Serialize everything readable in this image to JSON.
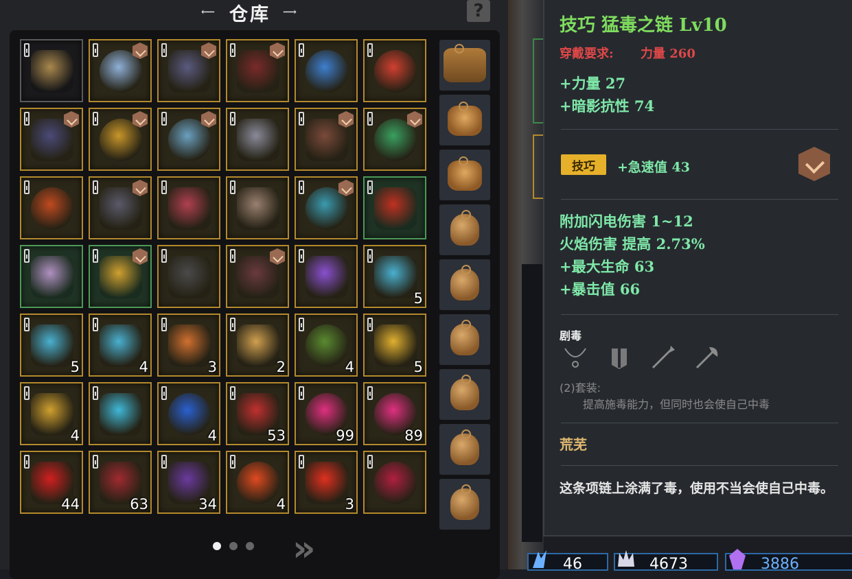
{
  "warehouse": {
    "title": "仓库",
    "help_label": "?",
    "items": [
      {
        "row": 0,
        "col": 0,
        "name": "backpack-item",
        "style": "dark",
        "rank": false,
        "count": "",
        "color": "#a9884d"
      },
      {
        "row": 0,
        "col": 1,
        "name": "ring-item",
        "style": "gold",
        "rank": true,
        "count": "",
        "color": "#8fb0d8"
      },
      {
        "row": 0,
        "col": 2,
        "name": "staff-item",
        "style": "gold",
        "rank": true,
        "count": "",
        "color": "#5a5a80"
      },
      {
        "row": 0,
        "col": 3,
        "name": "spiked-mace-item",
        "style": "gold",
        "rank": true,
        "count": "",
        "color": "#7a2a2a"
      },
      {
        "row": 0,
        "col": 4,
        "name": "blue-ring-item",
        "style": "gold",
        "rank": false,
        "count": "",
        "color": "#3e7fd0"
      },
      {
        "row": 0,
        "col": 5,
        "name": "ruby-ring-item",
        "style": "gold",
        "rank": false,
        "count": "",
        "color": "#d04030"
      },
      {
        "row": 1,
        "col": 0,
        "name": "boots-item",
        "style": "gold",
        "rank": true,
        "count": "",
        "color": "#4a4a78"
      },
      {
        "row": 1,
        "col": 1,
        "name": "gold-ring-item",
        "style": "gold",
        "rank": true,
        "count": "",
        "color": "#c8962a"
      },
      {
        "row": 1,
        "col": 2,
        "name": "gem-ring-item",
        "style": "gold",
        "rank": true,
        "count": "",
        "color": "#6aa0c0"
      },
      {
        "row": 1,
        "col": 3,
        "name": "helmet-item",
        "style": "gold",
        "rank": false,
        "count": "",
        "color": "#8a8a9a"
      },
      {
        "row": 1,
        "col": 4,
        "name": "club-item",
        "style": "gold",
        "rank": true,
        "count": "",
        "color": "#7a4a3a"
      },
      {
        "row": 1,
        "col": 5,
        "name": "emerald-ring-item",
        "style": "gold",
        "rank": true,
        "count": "",
        "color": "#3aa060"
      },
      {
        "row": 2,
        "col": 0,
        "name": "red-ring-item",
        "style": "gold",
        "rank": false,
        "count": "",
        "color": "#c04a20"
      },
      {
        "row": 2,
        "col": 1,
        "name": "scythe-item",
        "style": "gold",
        "rank": true,
        "count": "",
        "color": "#5a5a6a"
      },
      {
        "row": 2,
        "col": 2,
        "name": "robe-item",
        "style": "gold",
        "rank": false,
        "count": "",
        "color": "#b04050"
      },
      {
        "row": 2,
        "col": 3,
        "name": "armor-item",
        "style": "gold",
        "rank": false,
        "count": "",
        "color": "#9a8070"
      },
      {
        "row": 2,
        "col": 4,
        "name": "teal-ring-item",
        "style": "gold",
        "rank": true,
        "count": "",
        "color": "#3a9ab0"
      },
      {
        "row": 2,
        "col": 5,
        "name": "spear-item",
        "style": "green",
        "rank": false,
        "count": "",
        "color": "#c03020"
      },
      {
        "row": 3,
        "col": 0,
        "name": "blade-item",
        "style": "green",
        "rank": false,
        "count": "",
        "color": "#b090c0"
      },
      {
        "row": 3,
        "col": 1,
        "name": "necklace-item",
        "style": "green",
        "rank": true,
        "count": "",
        "color": "#d0a030"
      },
      {
        "row": 3,
        "col": 2,
        "name": "sword-item",
        "style": "gold",
        "rank": false,
        "count": "",
        "color": "#4a4a4a"
      },
      {
        "row": 3,
        "col": 3,
        "name": "scepter-item",
        "style": "gold",
        "rank": true,
        "count": "",
        "color": "#6a3a40"
      },
      {
        "row": 3,
        "col": 4,
        "name": "amethyst-item",
        "style": "gold",
        "rank": false,
        "count": "",
        "color": "#8a50d0"
      },
      {
        "row": 3,
        "col": 5,
        "name": "blue-scroll-item",
        "style": "gold",
        "rank": false,
        "count": "5",
        "color": "#4ab0d0"
      },
      {
        "row": 4,
        "col": 0,
        "name": "blue-scroll-item",
        "style": "gold",
        "rank": false,
        "count": "5",
        "color": "#4ab0d0"
      },
      {
        "row": 4,
        "col": 1,
        "name": "blue-scroll-item",
        "style": "gold",
        "rank": false,
        "count": "4",
        "color": "#4ab0d0"
      },
      {
        "row": 4,
        "col": 2,
        "name": "red-scroll-item",
        "style": "gold",
        "rank": false,
        "count": "3",
        "color": "#d07030"
      },
      {
        "row": 4,
        "col": 3,
        "name": "parchment-item",
        "style": "gold",
        "rank": false,
        "count": "2",
        "color": "#d0a050"
      },
      {
        "row": 4,
        "col": 4,
        "name": "green-rune-item",
        "style": "gold",
        "rank": false,
        "count": "4",
        "color": "#5a8a30"
      },
      {
        "row": 4,
        "col": 5,
        "name": "yellow-scroll-item",
        "style": "gold",
        "rank": false,
        "count": "5",
        "color": "#e0b030"
      },
      {
        "row": 5,
        "col": 0,
        "name": "yellow-scroll-item",
        "style": "gold",
        "rank": false,
        "count": "4",
        "color": "#d0a030"
      },
      {
        "row": 5,
        "col": 1,
        "name": "blue-crystal-item",
        "style": "gold",
        "rank": false,
        "count": "",
        "color": "#40b8d8"
      },
      {
        "row": 5,
        "col": 2,
        "name": "blue-orb-item",
        "style": "gold",
        "rank": false,
        "count": "4",
        "color": "#2a60d0"
      },
      {
        "row": 5,
        "col": 3,
        "name": "winged-emblem-item",
        "style": "gold",
        "rank": false,
        "count": "53",
        "color": "#c03030"
      },
      {
        "row": 5,
        "col": 4,
        "name": "pink-gem-item",
        "style": "gold",
        "rank": false,
        "count": "99",
        "color": "#e03080"
      },
      {
        "row": 5,
        "col": 5,
        "name": "pink-gem-item",
        "style": "gold",
        "rank": false,
        "count": "89",
        "color": "#e03080"
      },
      {
        "row": 6,
        "col": 0,
        "name": "red-crystal-item",
        "style": "gold",
        "rank": false,
        "count": "44",
        "color": "#d02020"
      },
      {
        "row": 6,
        "col": 1,
        "name": "red-ore-item",
        "style": "gold",
        "rank": false,
        "count": "63",
        "color": "#a02a30"
      },
      {
        "row": 6,
        "col": 2,
        "name": "purple-ore-item",
        "style": "gold",
        "rank": false,
        "count": "34",
        "color": "#6a3aa0"
      },
      {
        "row": 6,
        "col": 3,
        "name": "red-orb-item",
        "style": "gold",
        "rank": false,
        "count": "4",
        "color": "#e04a20"
      },
      {
        "row": 6,
        "col": 4,
        "name": "red-shard-item",
        "style": "gold",
        "rank": false,
        "count": "3",
        "color": "#e03020"
      },
      {
        "row": 6,
        "col": 5,
        "name": "crimson-orb-item",
        "style": "gold",
        "rank": false,
        "count": "",
        "color": "#b02040"
      }
    ],
    "bags": [
      {
        "kind": "big",
        "icon": "satchel-icon"
      },
      {
        "kind": "chest",
        "icon": "pouch-icon"
      },
      {
        "kind": "chest",
        "icon": "pouch-icon"
      },
      {
        "kind": "small",
        "icon": "bag-icon"
      },
      {
        "kind": "small",
        "icon": "bag-icon"
      },
      {
        "kind": "small",
        "icon": "bag-icon"
      },
      {
        "kind": "small",
        "icon": "bag-icon"
      },
      {
        "kind": "small",
        "icon": "bag-icon"
      },
      {
        "kind": "small",
        "icon": "bag-icon"
      }
    ],
    "pages": 3,
    "active_page": 0,
    "next_label": "»"
  },
  "tooltip": {
    "name": "技巧  猛毒之链  Lv10",
    "requirement_label": "穿戴要求:",
    "requirement_value": "力量  260",
    "base_stats": [
      "+力量  27",
      "+暗影抗性  74"
    ],
    "quality_tag": "技巧",
    "quality_stat": "+急速值  43",
    "extra_stats": [
      "附加闪电伤害  1~12",
      "火焰伤害  提高  2.73%",
      "+最大生命  63",
      "+暴击值  66"
    ],
    "set_name": "剧毒",
    "set_icons": [
      "necklace-icon",
      "armor-icon",
      "spear-icon",
      "axe-icon"
    ],
    "set_bonus_count": "(2)套装:",
    "set_bonus_desc": "提高施毒能力，但同时也会使自己中毒",
    "flavor_title": "荒芜",
    "flavor_text": "这条项链上涂满了毒，使用不当会使自己中毒。"
  },
  "currency": [
    {
      "icon": "blue-claw-icon",
      "value": "46",
      "color": "#6ab0ff"
    },
    {
      "icon": "silver-crown-icon",
      "value": "4673",
      "color": "#d8d8e8"
    },
    {
      "icon": "purple-crystal-icon",
      "value": "3886",
      "color": "#b070f0"
    }
  ],
  "colors": {
    "slot_gold_border": "#b48a2d",
    "slot_green_border": "#4d9a57",
    "tooltip_name": "#7fdc5e",
    "requirement": "#e04848",
    "stat_green": "#7fe8a8",
    "quality_tag_bg": "#e6b02a"
  }
}
